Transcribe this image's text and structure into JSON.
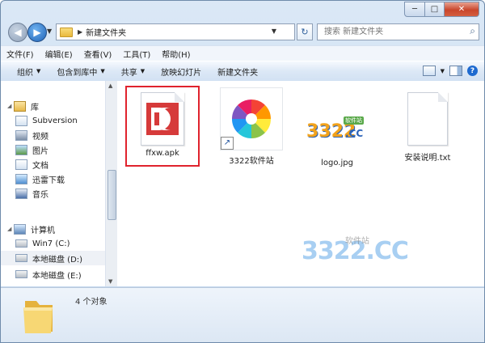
{
  "window": {
    "controls": {
      "minimize": "─",
      "maximize": "□",
      "close": "✕"
    }
  },
  "address_bar": {
    "back_glyph": "◀",
    "forward_glyph": "▶",
    "history_dropdown": "▼",
    "breadcrumb": [
      "新建文件夹"
    ],
    "refresh_glyph": "↻",
    "search_placeholder": "搜索 新建文件夹"
  },
  "menu": [
    "文件(F)",
    "编辑(E)",
    "查看(V)",
    "工具(T)",
    "帮助(H)"
  ],
  "toolbar": [
    {
      "label": "组织",
      "dropdown": true
    },
    {
      "label": "包含到库中",
      "dropdown": true
    },
    {
      "label": "共享",
      "dropdown": true
    },
    {
      "label": "放映幻灯片",
      "dropdown": false
    },
    {
      "label": "新建文件夹",
      "dropdown": false
    }
  ],
  "nav_pane": {
    "library": {
      "label": "库",
      "items": [
        "Subversion",
        "视频",
        "图片",
        "文档",
        "迅雷下载",
        "音乐"
      ]
    },
    "computer": {
      "label": "计算机",
      "items": [
        "Win7 (C:)",
        "本地磁盘 (D:)",
        "本地磁盘 (E:)"
      ]
    }
  },
  "files": [
    {
      "name": "ffxw.apk",
      "icon": "apk-icon",
      "selected": true
    },
    {
      "name": "3322软件站",
      "icon": "shortcut-icon",
      "selected": false
    },
    {
      "name": "logo.jpg",
      "icon": "image-icon",
      "selected": false
    },
    {
      "name": "安装说明.txt",
      "icon": "text-file-icon",
      "selected": false
    }
  ],
  "watermark": {
    "text": "3322.CC",
    "subtitle": "软件站"
  },
  "logo_thumbnail": {
    "text": "3322",
    "suffix": ".CC",
    "badge": "软件站"
  },
  "status": {
    "count_text": "4 个对象"
  },
  "colors": {
    "selection_border": "#e0232d",
    "apk_red": "#d63a3a"
  }
}
